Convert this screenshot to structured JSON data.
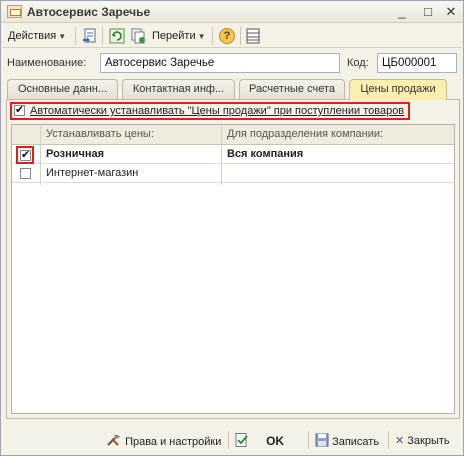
{
  "window": {
    "title": "Автосервис Заречье",
    "controls": [
      "_",
      "□",
      "✕"
    ]
  },
  "toolbar": {
    "actions_label": "Действия",
    "goto_label": "Перейти",
    "help_label": "?"
  },
  "form": {
    "name_label": "Наименование:",
    "name_value": "Автосервис Заречье",
    "code_label": "Код:",
    "code_value": "ЦБ000001"
  },
  "tabs": [
    {
      "label": "Основные данн...",
      "active": false
    },
    {
      "label": "Контактная инф...",
      "active": false
    },
    {
      "label": "Расчетные счета",
      "active": false
    },
    {
      "label": "Цены продажи",
      "active": true
    }
  ],
  "auto_prices": {
    "checked": true,
    "label": "Автоматически устанавливать \"Цены продажи\" при поступлении товаров"
  },
  "grid": {
    "columns": [
      "Устанавливать цены:",
      "Для подразделения компании:"
    ],
    "rows": [
      {
        "checked": true,
        "price_type": "Розничная",
        "division": "Вся компания",
        "bold": true
      },
      {
        "checked": false,
        "price_type": "Интернет-магазин",
        "division": "",
        "bold": false
      }
    ]
  },
  "bottom": {
    "rights_label": "Права и настройки",
    "ok_label": "OK",
    "save_label": "Записать",
    "close_label": "Закрыть"
  },
  "colors": {
    "highlight_red": "#e02020",
    "active_tab": "#fbefb0",
    "window_bg": "#f4f1e7"
  }
}
